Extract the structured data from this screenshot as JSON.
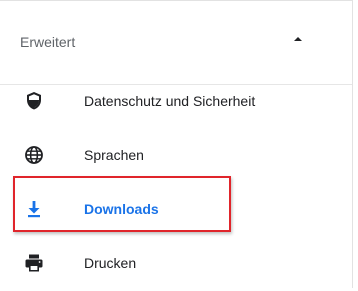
{
  "section": {
    "title": "Erweitert",
    "expanded": true,
    "collapse_icon": "triangle-up-icon"
  },
  "nav": {
    "items": [
      {
        "id": "privacy",
        "label": "Datenschutz und Sicherheit",
        "icon": "shield-icon",
        "active": false
      },
      {
        "id": "languages",
        "label": "Sprachen",
        "icon": "globe-icon",
        "active": false
      },
      {
        "id": "downloads",
        "label": "Downloads",
        "icon": "download-icon",
        "active": true
      },
      {
        "id": "print",
        "label": "Drucken",
        "icon": "printer-icon",
        "active": false
      }
    ]
  },
  "colors": {
    "accent": "#1a73e8",
    "icon": "#5f6368",
    "text": "#202124",
    "highlight": "#e0252b"
  }
}
